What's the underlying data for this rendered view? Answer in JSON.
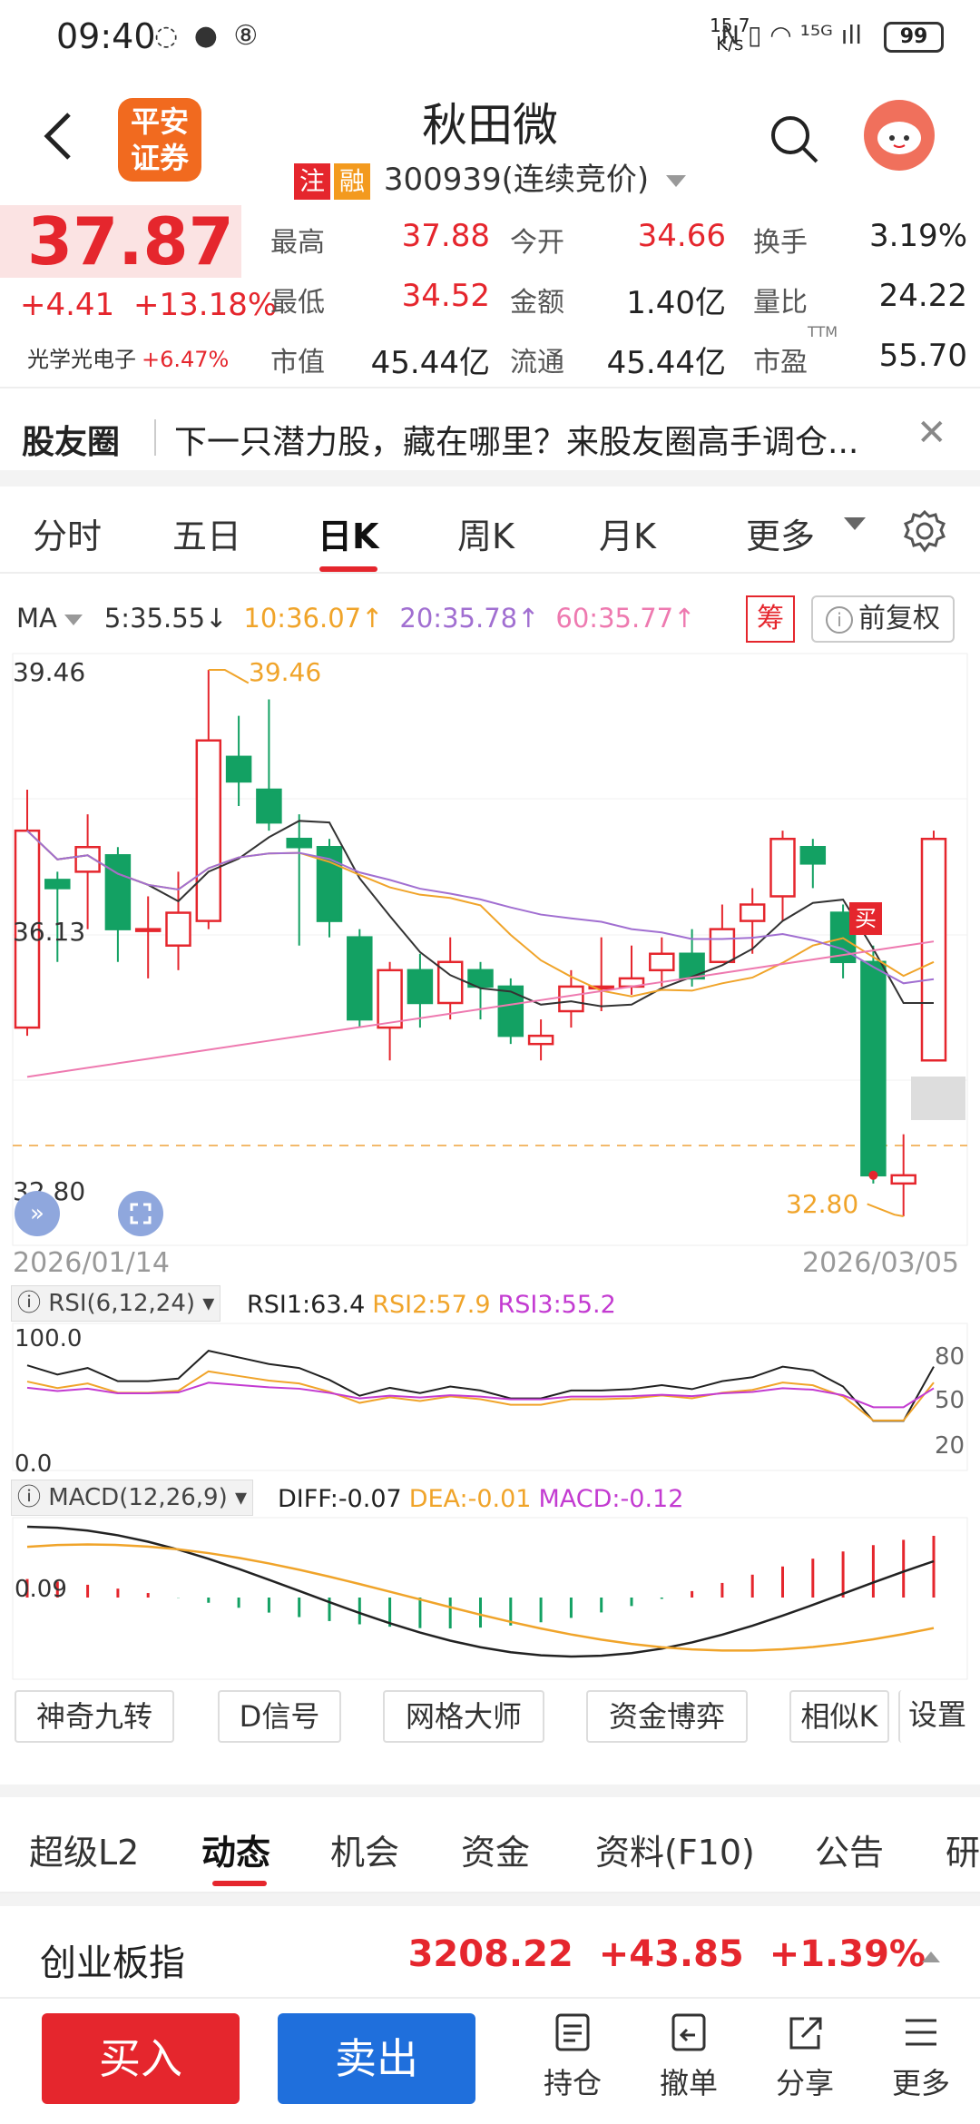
{
  "status": {
    "time": "09:40",
    "left_icons": "◌ ● ⑧",
    "net_speed_top": "15.7",
    "net_speed_bottom": "K/s",
    "right_icons": "N ▯ ◠ ¹⁵ᴳ ıll",
    "battery": "99"
  },
  "header": {
    "logo_line1": "平安",
    "logo_line2": "证券",
    "stock_name": "秋田微",
    "tag1": "注",
    "tag2": "融",
    "code": "300939",
    "status_text": "(连续竞价)"
  },
  "quote": {
    "price": "37.87",
    "change": "+4.41",
    "change_pct": "+13.18%",
    "sector_name": "光学光电子",
    "sector_pct": "+6.47%",
    "stats": [
      {
        "label": "最高",
        "value": "37.88",
        "color": "#e5262d"
      },
      {
        "label": "今开",
        "value": "34.66",
        "color": "#e5262d"
      },
      {
        "label": "换手",
        "value": "3.19%",
        "color": "#222222"
      },
      {
        "label": "最低",
        "value": "34.52",
        "color": "#e5262d"
      },
      {
        "label": "金额",
        "value": "1.40亿",
        "color": "#222222"
      },
      {
        "label": "量比",
        "value": "24.22",
        "color": "#222222"
      },
      {
        "label": "市值",
        "value": "45.44亿",
        "color": "#222222"
      },
      {
        "label": "流通",
        "value": "45.44亿",
        "color": "#222222"
      },
      {
        "label": "市盈",
        "value": "55.70",
        "color": "#222222"
      }
    ],
    "pe_superscript": "TTM"
  },
  "banner": {
    "title": "股友圈",
    "message": "下一只潜力股，藏在哪里？来股友圈高手调仓...",
    "close": "✕"
  },
  "tabs": [
    "分时",
    "五日",
    "日K",
    "周K",
    "月K",
    "更多"
  ],
  "active_tab": "日K",
  "ma_legend": {
    "label": "MA",
    "ma5": "5:35.55↓",
    "ma10": "10:36.07↑",
    "ma20": "20:35.78↑",
    "ma60": "60:35.77↑",
    "chou": "筹",
    "fuquan": "前复权",
    "info_icon": "i"
  },
  "kline": {
    "y_top_label": "39.46",
    "y_mid_label": "36.13",
    "y_bottom_label": "32.80",
    "high_annotation": "39.46",
    "low_annotation": "32.80",
    "date_start": "2026/01/14",
    "date_end": "2026/03/05",
    "buy_marker": "买",
    "candles": [
      {
        "o": 35.1,
        "c": 37.5,
        "h": 38.0,
        "l": 35.0
      },
      {
        "o": 36.9,
        "c": 36.8,
        "h": 37.0,
        "l": 35.9
      },
      {
        "o": 37.0,
        "c": 37.3,
        "h": 37.7,
        "l": 36.3
      },
      {
        "o": 37.2,
        "c": 36.3,
        "h": 37.3,
        "l": 35.9
      },
      {
        "o": 36.3,
        "c": 36.3,
        "h": 36.7,
        "l": 35.7
      },
      {
        "o": 36.1,
        "c": 36.5,
        "h": 37.0,
        "l": 35.8
      },
      {
        "o": 36.4,
        "c": 38.6,
        "h": 39.46,
        "l": 36.3
      },
      {
        "o": 38.4,
        "c": 38.1,
        "h": 38.9,
        "l": 37.8
      },
      {
        "o": 38.0,
        "c": 37.6,
        "h": 39.1,
        "l": 37.5
      },
      {
        "o": 37.4,
        "c": 37.3,
        "h": 37.7,
        "l": 36.1
      },
      {
        "o": 37.3,
        "c": 36.4,
        "h": 37.4,
        "l": 36.2
      },
      {
        "o": 36.2,
        "c": 35.2,
        "h": 36.3,
        "l": 35.1
      },
      {
        "o": 35.1,
        "c": 35.8,
        "h": 35.9,
        "l": 34.7
      },
      {
        "o": 35.8,
        "c": 35.4,
        "h": 36.0,
        "l": 35.1
      },
      {
        "o": 35.4,
        "c": 35.9,
        "h": 36.2,
        "l": 35.2
      },
      {
        "o": 35.8,
        "c": 35.6,
        "h": 35.9,
        "l": 35.2
      },
      {
        "o": 35.6,
        "c": 35.0,
        "h": 35.7,
        "l": 34.9
      },
      {
        "o": 34.9,
        "c": 35.0,
        "h": 35.2,
        "l": 34.7
      },
      {
        "o": 35.3,
        "c": 35.6,
        "h": 35.8,
        "l": 35.1
      },
      {
        "o": 35.6,
        "c": 35.6,
        "h": 36.2,
        "l": 35.3
      },
      {
        "o": 35.6,
        "c": 35.7,
        "h": 36.1,
        "l": 35.5
      },
      {
        "o": 35.8,
        "c": 36.0,
        "h": 36.2,
        "l": 35.6
      },
      {
        "o": 36.0,
        "c": 35.7,
        "h": 36.3,
        "l": 35.6
      },
      {
        "o": 35.9,
        "c": 36.3,
        "h": 36.6,
        "l": 35.9
      },
      {
        "o": 36.4,
        "c": 36.6,
        "h": 36.8,
        "l": 36.0
      },
      {
        "o": 36.7,
        "c": 37.4,
        "h": 37.5,
        "l": 36.4
      },
      {
        "o": 37.3,
        "c": 37.1,
        "h": 37.4,
        "l": 36.8
      },
      {
        "o": 36.5,
        "c": 35.9,
        "h": 36.6,
        "l": 35.7
      },
      {
        "o": 35.9,
        "c": 33.3,
        "h": 36.1,
        "l": 33.2
      },
      {
        "o": 33.2,
        "c": 33.3,
        "h": 33.8,
        "l": 32.8
      },
      {
        "o": 34.7,
        "c": 37.4,
        "h": 37.5,
        "l": 34.7
      }
    ]
  },
  "rsi": {
    "label": "RSI(6,12,24)",
    "rsi1": "RSI1:63.4",
    "rsi2": "RSI2:57.9",
    "rsi3": "RSI3:55.2",
    "y_top": "100.0",
    "y_bottom": "0.0",
    "right_80": "80",
    "right_50": "50",
    "right_20": "20"
  },
  "macd": {
    "label": "MACD(12,26,9)",
    "diff": "DIFF:-0.07",
    "dea": "DEA:-0.01",
    "macd": "MACD:-0.12",
    "y_label": "0.09"
  },
  "tools": [
    "神奇九转",
    "D信号",
    "网格大师",
    "资金博弈",
    "相似K",
    "设置"
  ],
  "tabs2": [
    "超级L2",
    "动态",
    "机会",
    "资金",
    "资料(F10)",
    "公告",
    "研"
  ],
  "active_tab2": "动态",
  "index": {
    "name": "创业板指",
    "value": "3208.22",
    "change": "+43.85",
    "pct": "+1.39%"
  },
  "bottom": {
    "buy": "买入",
    "sell": "卖出",
    "items": [
      "持仓",
      "撤单",
      "分享",
      "更多"
    ]
  },
  "colors": {
    "up": "#e5262d",
    "down": "#13a163",
    "ma5": "#333333",
    "ma10": "#f0a42a",
    "ma20": "#a16fd1",
    "ma60": "#ee7ab0"
  }
}
